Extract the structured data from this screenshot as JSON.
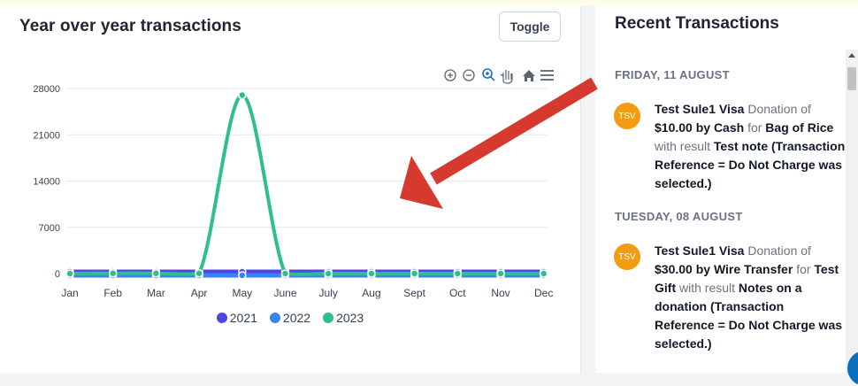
{
  "chart_card": {
    "title": "Year over year transactions",
    "toggle_label": "Toggle",
    "toolbar_icons": [
      "zoom-in-icon",
      "zoom-out-icon",
      "zoom-select-icon",
      "pan-hand-icon",
      "home-reset-icon",
      "menu-icon"
    ]
  },
  "chart_data": {
    "type": "line",
    "title": "",
    "xlabel": "",
    "ylabel": "",
    "categories": [
      "Jan",
      "Feb",
      "Mar",
      "Apr",
      "May",
      "June",
      "July",
      "Aug",
      "Sept",
      "Oct",
      "Nov",
      "Dec"
    ],
    "y_ticks": [
      "0",
      "7000",
      "14000",
      "21000",
      "28000"
    ],
    "ylim": [
      0,
      28000
    ],
    "grid": true,
    "legend_position": "bottom",
    "series": [
      {
        "name": "2021",
        "color": "#4f46e5",
        "values": [
          0,
          0,
          0,
          0,
          0,
          0,
          0,
          0,
          0,
          0,
          0,
          0
        ]
      },
      {
        "name": "2022",
        "color": "#3b82f6",
        "values": [
          0,
          0,
          0,
          0,
          0,
          0,
          0,
          0,
          0,
          0,
          0,
          0
        ]
      },
      {
        "name": "2023",
        "color": "#2fbf8f",
        "values": [
          0,
          40,
          40,
          40,
          27000,
          0,
          0,
          0,
          0,
          0,
          0,
          0
        ]
      }
    ]
  },
  "recent": {
    "title": "Recent Transactions",
    "groups": [
      {
        "date": "FRIDAY, 11 AUGUST",
        "avatar": "TSV",
        "name": "Test Sule1 Visa",
        "w1": "Donation",
        "w2": "of",
        "amount": "$10.00 by Cash",
        "w3": "for",
        "item": "Bag of Rice",
        "w4": "with result",
        "result": "Test note (Transaction Reference = Do Not Charge was selected.)"
      },
      {
        "date": "TUESDAY, 08 AUGUST",
        "avatar": "TSV",
        "name": "Test Sule1 Visa",
        "w1": "Donation",
        "w2": "of",
        "amount": "$30.00 by Wire Transfer",
        "w3": "for",
        "item": "Test Gift",
        "w4": "with result",
        "result": "Notes on a donation (Transaction Reference = Do Not Charge was selected.)"
      }
    ]
  },
  "colors": {
    "arrow": "#d63a2f",
    "avatar": "#f39c12",
    "accent": "#0a6ebd"
  }
}
